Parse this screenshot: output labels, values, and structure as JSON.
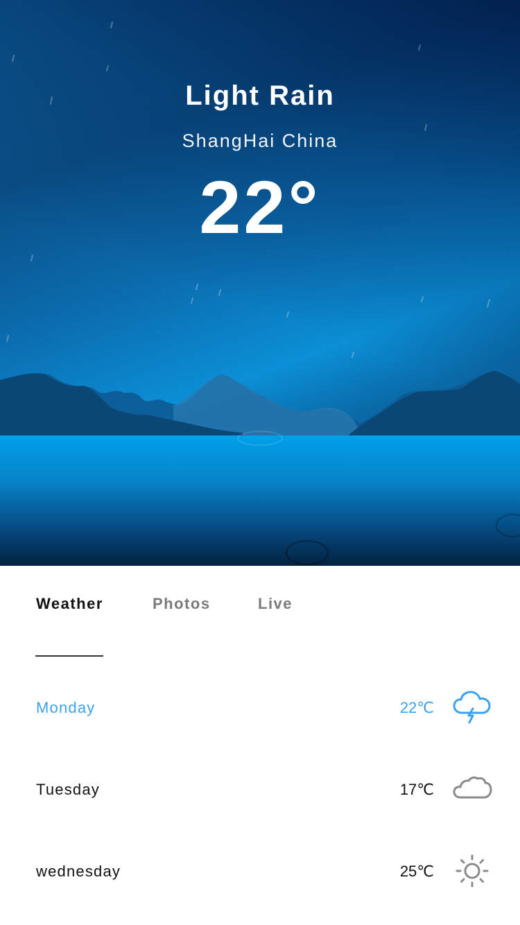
{
  "hero": {
    "condition": "Light Rain",
    "location": "ShangHai China",
    "temperature": "22°"
  },
  "tabs": [
    {
      "label": "Weather",
      "active": true
    },
    {
      "label": "Photos",
      "active": false
    },
    {
      "label": "Live",
      "active": false
    }
  ],
  "forecast": [
    {
      "day": "Monday",
      "temp": "22℃",
      "icon": "thunderstorm-cloud-icon",
      "highlight": true
    },
    {
      "day": "Tuesday",
      "temp": "17℃",
      "icon": "cloud-icon",
      "highlight": false
    },
    {
      "day": "wednesday",
      "temp": "25℃",
      "icon": "sun-icon",
      "highlight": false
    }
  ],
  "colors": {
    "accent": "#3aa2ee",
    "icon_gray": "#8a8a8a",
    "sky_dark": "#0a3a6e",
    "sky_light": "#0b8fd6",
    "water": "#0097e0"
  }
}
